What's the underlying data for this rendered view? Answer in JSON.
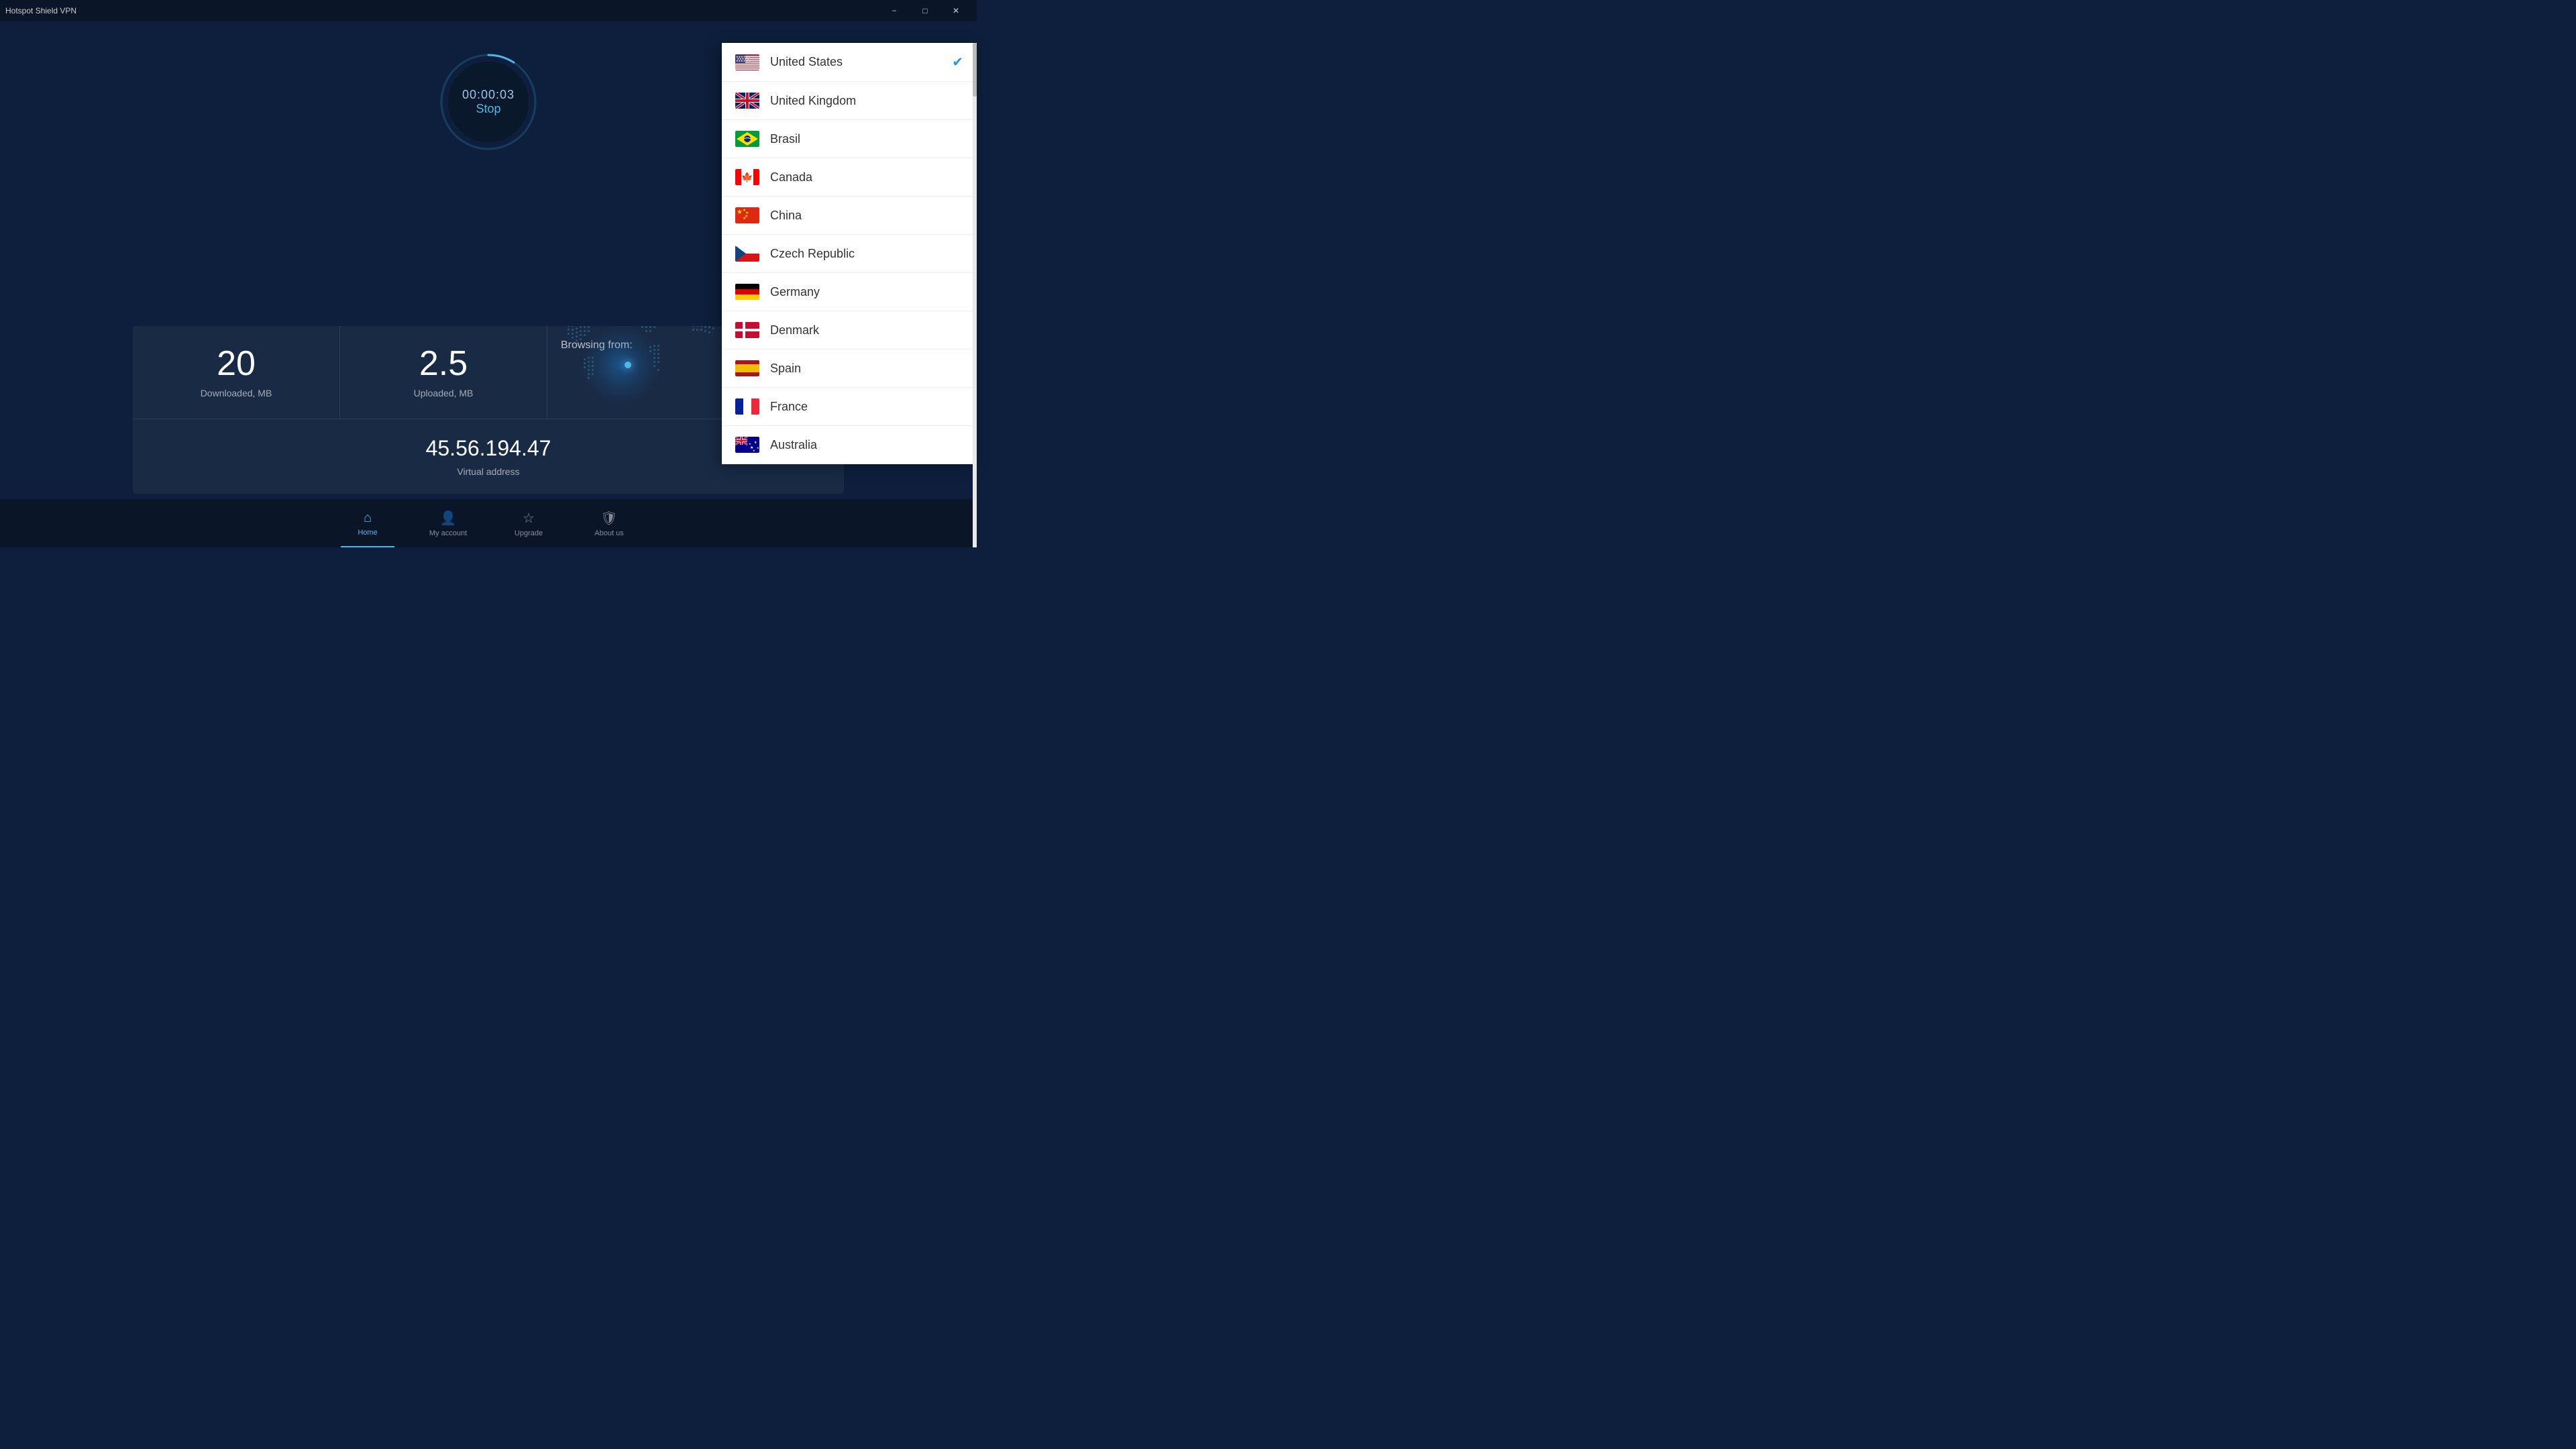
{
  "app": {
    "title": "Hotspot Shield VPN"
  },
  "titlebar": {
    "minimize_label": "−",
    "maximize_label": "□",
    "close_label": "✕"
  },
  "vpn": {
    "timer": "00:00:03",
    "stop_label": "Stop",
    "downloaded_value": "20",
    "downloaded_label": "Downloaded, MB",
    "uploaded_value": "2.5",
    "uploaded_label": "Uploaded, MB",
    "browsing_from_label": "Browsing from:",
    "virtual_address": "45.56.194.47",
    "virtual_label": "Virtual address"
  },
  "nav": {
    "items": [
      {
        "id": "home",
        "label": "Home",
        "active": true,
        "icon": "home"
      },
      {
        "id": "my-account",
        "label": "My account",
        "active": false,
        "icon": "person"
      },
      {
        "id": "upgrade",
        "label": "Upgrade",
        "active": false,
        "icon": "star"
      },
      {
        "id": "about-us",
        "label": "About us",
        "active": false,
        "icon": "shield"
      }
    ]
  },
  "country_dropdown": {
    "countries": [
      {
        "id": "us",
        "name": "United States",
        "selected": true,
        "flag_type": "us"
      },
      {
        "id": "uk",
        "name": "United Kingdom",
        "selected": false,
        "flag_type": "uk"
      },
      {
        "id": "br",
        "name": "Brasil",
        "selected": false,
        "flag_type": "br"
      },
      {
        "id": "ca",
        "name": "Canada",
        "selected": false,
        "flag_type": "ca"
      },
      {
        "id": "cn",
        "name": "China",
        "selected": false,
        "flag_type": "cn"
      },
      {
        "id": "cz",
        "name": "Czech Republic",
        "selected": false,
        "flag_type": "cz"
      },
      {
        "id": "de",
        "name": "Germany",
        "selected": false,
        "flag_type": "de"
      },
      {
        "id": "dk",
        "name": "Denmark",
        "selected": false,
        "flag_type": "dk"
      },
      {
        "id": "es",
        "name": "Spain",
        "selected": false,
        "flag_type": "es"
      },
      {
        "id": "fr",
        "name": "France",
        "selected": false,
        "flag_type": "fr"
      },
      {
        "id": "au",
        "name": "Australia",
        "selected": false,
        "flag_type": "au"
      }
    ]
  },
  "colors": {
    "accent": "#4db8e8",
    "background": "#0d1f3c",
    "darkBackground": "#0a1628",
    "checkmark": "#2196F3"
  }
}
